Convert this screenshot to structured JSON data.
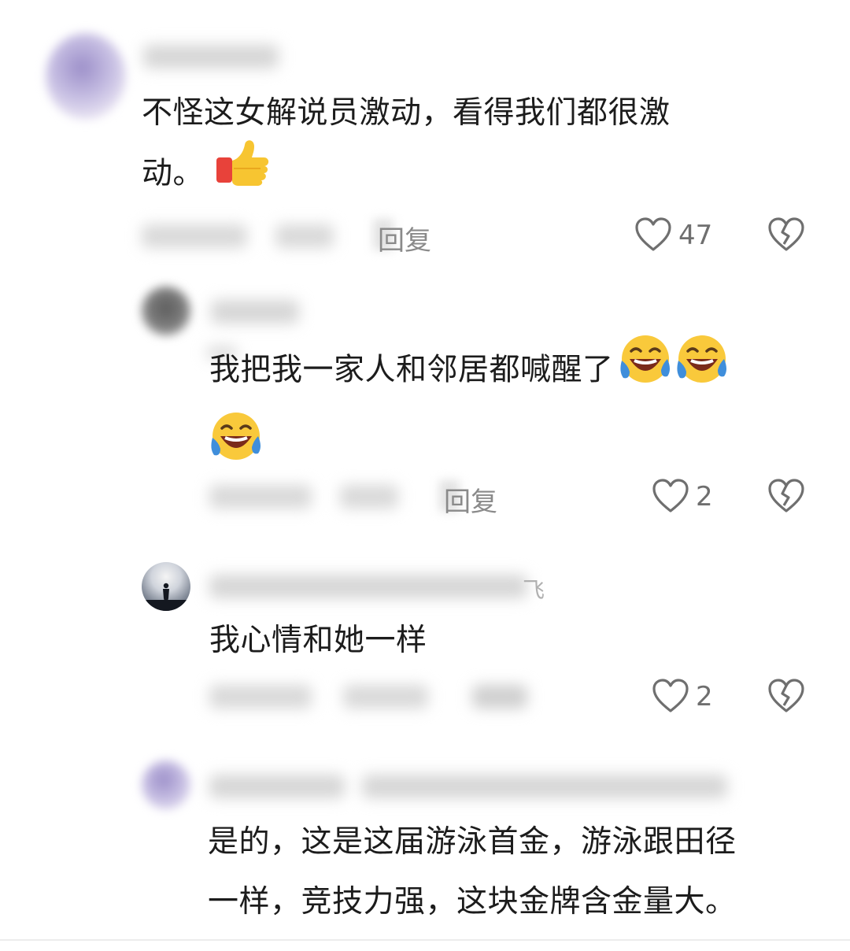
{
  "comments": [
    {
      "text_line1": "不怪这女解说员激动，看得我们都很激",
      "text_line2": "动。",
      "emoji": "thumbs-up",
      "reply_label": "回复",
      "likes": "47"
    },
    {
      "text_line1": "我把我一家人和邻居都喊醒了",
      "emoji": "laughing-tears",
      "reply_label": "回复",
      "likes": "2"
    },
    {
      "name_tail": "飞",
      "text_line1": "我心情和她一样",
      "likes": "2"
    },
    {
      "text_line1": "是的，这是这届游泳首金，游泳跟田径",
      "text_line2": "一样，竞技力强，这块金牌含金量大。"
    }
  ]
}
